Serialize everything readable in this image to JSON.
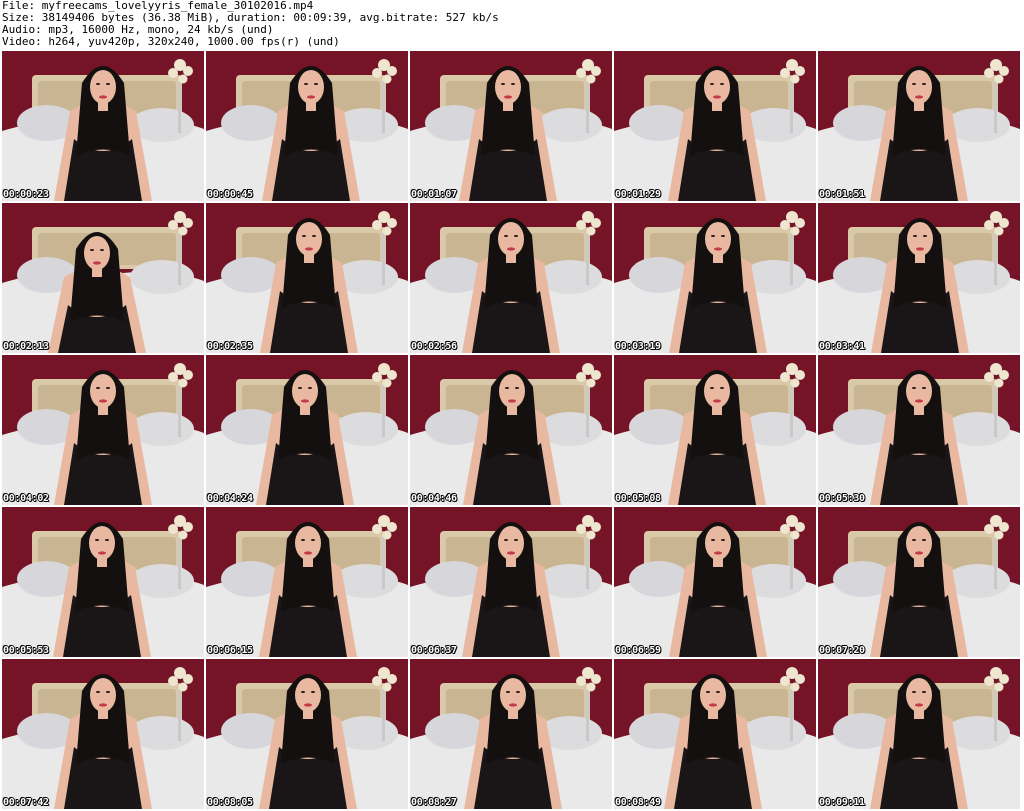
{
  "header": {
    "file_line": "File: myfreecams_lovelyyris_female_30102016.mp4",
    "size_line": "Size: 38149406 bytes (36.38 MiB), duration: 00:09:39, avg.bitrate: 527 kb/s",
    "audio_line": "Audio: mp3, 16000 Hz, mono, 24 kb/s (und)",
    "video_line": "Video: h264, yuv420p, 320x240, 1000.00 fps(r) (und)"
  },
  "thumbnails": [
    {
      "timestamp": "00:00:23"
    },
    {
      "timestamp": "00:00:45"
    },
    {
      "timestamp": "00:01:07"
    },
    {
      "timestamp": "00:01:29"
    },
    {
      "timestamp": "00:01:51"
    },
    {
      "timestamp": "00:02:13"
    },
    {
      "timestamp": "00:02:35"
    },
    {
      "timestamp": "00:02:56"
    },
    {
      "timestamp": "00:03:19"
    },
    {
      "timestamp": "00:03:41"
    },
    {
      "timestamp": "00:04:02"
    },
    {
      "timestamp": "00:04:24"
    },
    {
      "timestamp": "00:04:46"
    },
    {
      "timestamp": "00:05:08"
    },
    {
      "timestamp": "00:05:30"
    },
    {
      "timestamp": "00:05:53"
    },
    {
      "timestamp": "00:06:15"
    },
    {
      "timestamp": "00:06:37"
    },
    {
      "timestamp": "00:06:59"
    },
    {
      "timestamp": "00:07:20"
    },
    {
      "timestamp": "00:07:42"
    },
    {
      "timestamp": "00:08:05"
    },
    {
      "timestamp": "00:08:27"
    },
    {
      "timestamp": "00:08:49"
    },
    {
      "timestamp": "00:09:11"
    }
  ],
  "colors": {
    "wall": "#741426",
    "bed": "#e9e9ea",
    "headboard": "#d9c9a8",
    "skin": "#e8b9a0",
    "hair": "#141010",
    "dress": "#1a1618",
    "flowers": "#efe6cf",
    "timestamp_text": "#ffffff"
  }
}
